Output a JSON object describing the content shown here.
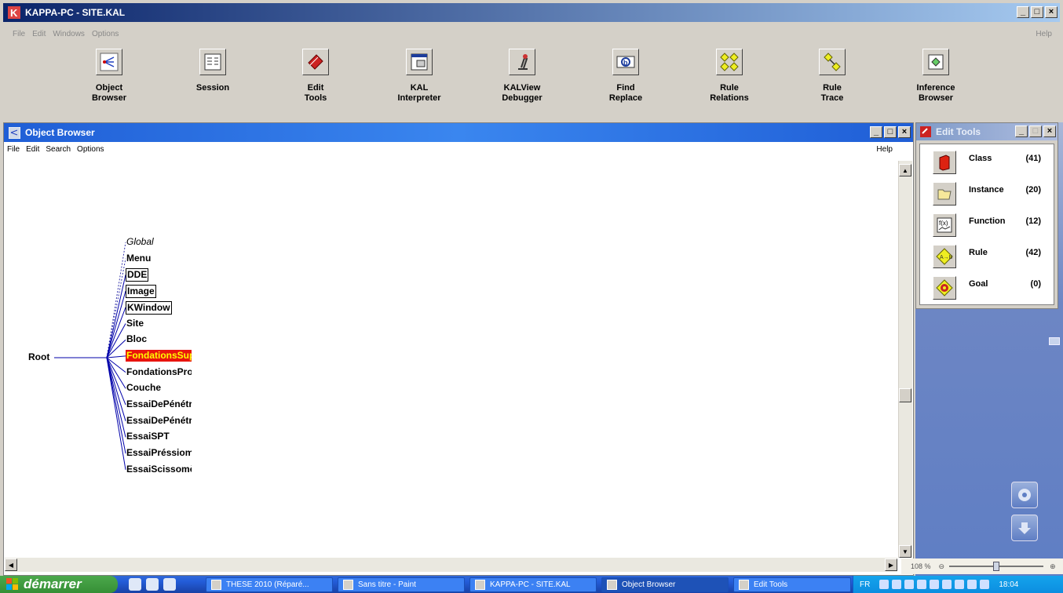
{
  "main_window": {
    "title": "KAPPA-PC - SITE.KAL",
    "menu": [
      "File",
      "Edit",
      "Windows",
      "Options"
    ],
    "help": "Help"
  },
  "toolbar": [
    {
      "name": "object-browser",
      "label": "Object\nBrowser",
      "icon": "object-browser-icon"
    },
    {
      "name": "session",
      "label": "Session",
      "icon": "session-icon"
    },
    {
      "name": "edit-tools",
      "label": "Edit\nTools",
      "icon": "edit-tools-icon"
    },
    {
      "name": "kal-interpreter",
      "label": "KAL\nInterpreter",
      "icon": "kal-interpreter-icon"
    },
    {
      "name": "kalview-debugger",
      "label": "KALView\nDebugger",
      "icon": "microscope-icon"
    },
    {
      "name": "find-replace",
      "label": "Find\nReplace",
      "icon": "find-replace-icon"
    },
    {
      "name": "rule-relations",
      "label": "Rule\nRelations",
      "icon": "rule-relations-icon"
    },
    {
      "name": "rule-trace",
      "label": "Rule\nTrace",
      "icon": "rule-trace-icon"
    },
    {
      "name": "inference-browser",
      "label": "Inference\nBrowser",
      "icon": "inference-browser-icon"
    }
  ],
  "object_browser": {
    "title": "Object Browser",
    "menu": [
      "File",
      "Edit",
      "Search",
      "Options"
    ],
    "help": "Help",
    "root": "Root",
    "children": [
      {
        "label": "Global",
        "style": "italic"
      },
      {
        "label": "Menu",
        "style": "plain"
      },
      {
        "label": "DDE",
        "style": "boxed"
      },
      {
        "label": "Image",
        "style": "boxed"
      },
      {
        "label": "KWindow",
        "style": "boxed"
      },
      {
        "label": "Site",
        "style": "plain"
      },
      {
        "label": "Bloc",
        "style": "plain"
      },
      {
        "label": "FondationsSup",
        "style": "selected"
      },
      {
        "label": "FondationsPro",
        "style": "plain"
      },
      {
        "label": "Couche",
        "style": "plain"
      },
      {
        "label": "EssaiDePénétr",
        "style": "plain"
      },
      {
        "label": "EssaiDePénétr",
        "style": "plain"
      },
      {
        "label": "EssaiSPT",
        "style": "plain"
      },
      {
        "label": "EssaiPréssiom",
        "style": "plain"
      },
      {
        "label": "EssaiScissomè",
        "style": "plain"
      }
    ]
  },
  "edit_tools": {
    "title": "Edit Tools",
    "items": [
      {
        "label": "Class",
        "count": "(41)",
        "icon": "class-book-icon"
      },
      {
        "label": "Instance",
        "count": "(20)",
        "icon": "instance-folder-icon"
      },
      {
        "label": "Function",
        "count": "(12)",
        "icon": "function-icon"
      },
      {
        "label": "Rule",
        "count": "(42)",
        "icon": "rule-diamond-icon"
      },
      {
        "label": "Goal",
        "count": "(0)",
        "icon": "goal-target-icon"
      }
    ]
  },
  "zoom": {
    "value": "108 %"
  },
  "taskbar": {
    "start": "démarrer",
    "tasks": [
      {
        "label": "THESE 2010 (Réparé..."
      },
      {
        "label": "Sans titre - Paint"
      },
      {
        "label": "KAPPA-PC - SITE.KAL"
      },
      {
        "label": "Object Browser",
        "active": true
      },
      {
        "label": "Edit Tools"
      }
    ],
    "lang": "FR",
    "clock": "18:04"
  }
}
